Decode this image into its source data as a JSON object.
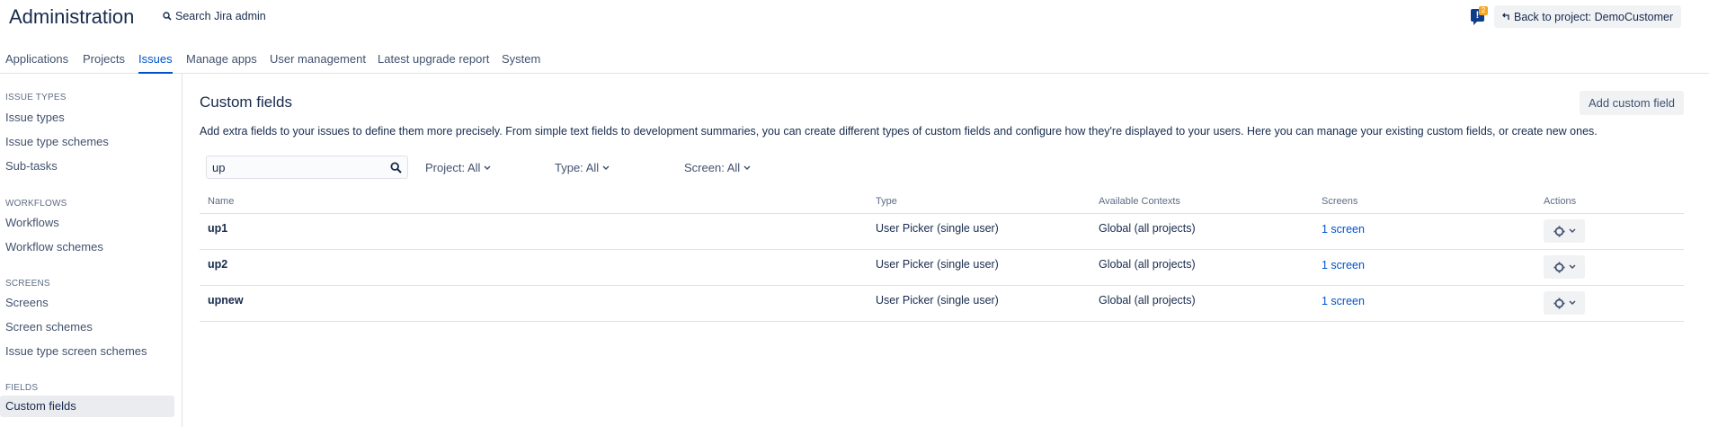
{
  "header": {
    "title": "Administration",
    "search_label": "Search Jira admin",
    "notification_count": "2",
    "back_button_label": "Back to project: DemoCustomer"
  },
  "tabs": [
    {
      "label": "Applications"
    },
    {
      "label": "Projects"
    },
    {
      "label": "Issues",
      "active": true
    },
    {
      "label": "Manage apps"
    },
    {
      "label": "User management"
    },
    {
      "label": "Latest upgrade report"
    },
    {
      "label": "System"
    }
  ],
  "sidebar": {
    "sections": [
      {
        "heading": "ISSUE TYPES",
        "items": [
          "Issue types",
          "Issue type schemes",
          "Sub-tasks"
        ]
      },
      {
        "heading": "WORKFLOWS",
        "items": [
          "Workflows",
          "Workflow schemes"
        ]
      },
      {
        "heading": "SCREENS",
        "items": [
          "Screens",
          "Screen schemes",
          "Issue type screen schemes"
        ]
      },
      {
        "heading": "FIELDS",
        "items": [
          "Custom fields"
        ]
      }
    ],
    "selected": "Custom fields"
  },
  "main": {
    "title": "Custom fields",
    "add_button_label": "Add custom field",
    "description": "Add extra fields to your issues to define them more precisely. From simple text fields to development summaries, you can create different types of custom fields and configure how they're displayed to your users. Here you can manage your existing custom fields, or create new ones.",
    "filter": {
      "value": "up",
      "project_label": "Project: All",
      "type_label": "Type: All",
      "screen_label": "Screen: All"
    },
    "table": {
      "headers": [
        "Name",
        "Type",
        "Available Contexts",
        "Screens",
        "Actions"
      ],
      "rows": [
        {
          "name": "up1",
          "type": "User Picker (single user)",
          "contexts": "Global (all projects)",
          "screens": "1 screen"
        },
        {
          "name": "up2",
          "type": "User Picker (single user)",
          "contexts": "Global (all projects)",
          "screens": "1 screen"
        },
        {
          "name": "upnew",
          "type": "User Picker (single user)",
          "contexts": "Global (all projects)",
          "screens": "1 screen"
        }
      ]
    }
  },
  "colors": {
    "accent": "#0052cc",
    "text": "#172b4d",
    "muted": "#5e6c84",
    "border": "#dfe1e6",
    "notification": "#f5a623"
  }
}
